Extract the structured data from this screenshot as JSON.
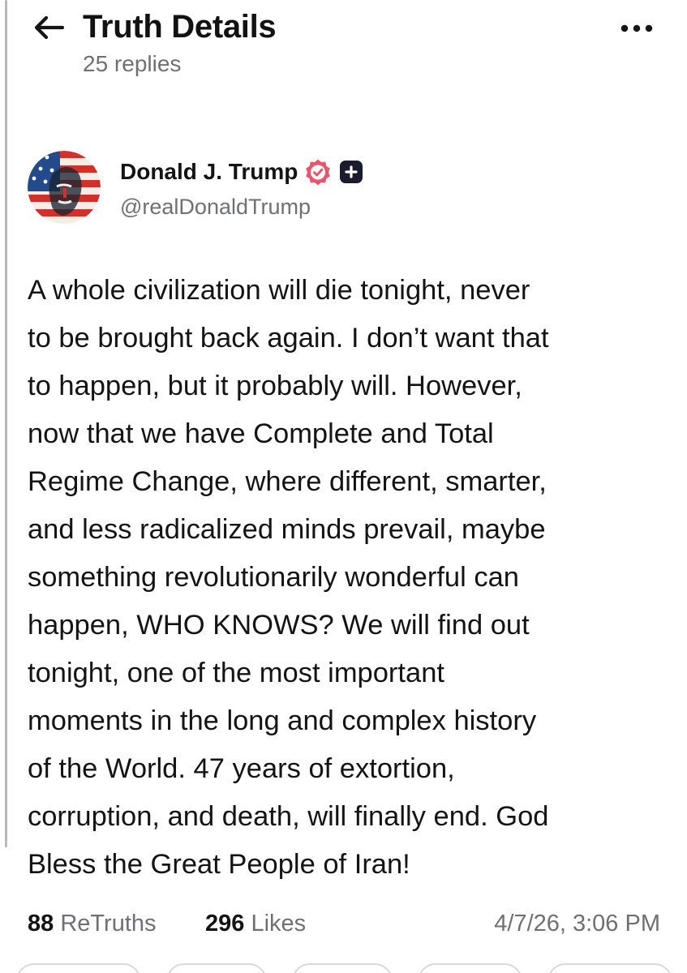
{
  "header": {
    "title": "Truth Details",
    "subtitle": "25 replies",
    "back_icon": "arrow-left-icon",
    "more_icon": "ellipsis-horizontal-icon"
  },
  "author": {
    "name": "Donald J. Trump",
    "handle": "@realDonaldTrump",
    "verified_icon": "verified-badge-icon",
    "plus_icon": "plus-badge-icon",
    "verified_color": "#e8556c"
  },
  "post": {
    "text": "A whole civilization will die tonight, never\nto be brought back again. I don’t want that\nto happen, but it probably will. However,\nnow that we have Complete and Total\nRegime Change, where different, smarter,\nand less radicalized minds prevail, maybe\nsomething revolutionarily wonderful can\nhappen, WHO KNOWS? We will find out\ntonight, one of the most important\nmoments in the long and complex history\nof the World. 47 years of extortion,\ncorruption, and death, will finally end. God\nBless the Great People of Iran!"
  },
  "stats": {
    "retruths_count": "88",
    "retruths_label": "ReTruths",
    "likes_count": "296",
    "likes_label": "Likes",
    "timestamp": "4/7/26, 3:06 PM"
  }
}
